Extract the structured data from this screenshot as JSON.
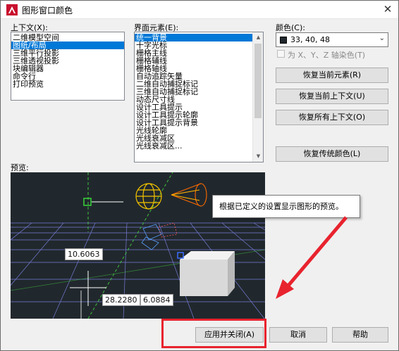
{
  "window": {
    "title": "图形窗口颜色",
    "close_glyph": "✕"
  },
  "context": {
    "label": "上下文(X):",
    "items": [
      "二维模型空间",
      "图纸/布局",
      "三维平行投影",
      "三维透视投影",
      "块编辑器",
      "命令行",
      "打印预览"
    ],
    "selected_index": 1
  },
  "elements": {
    "label": "界面元素(E):",
    "items": [
      "统一背景",
      "十字光标",
      "栅格主线",
      "栅格辅线",
      "栅格轴线",
      "自动追踪矢量",
      "二维自动捕捉标记",
      "三维自动捕捉标记",
      "动态尺寸线",
      "设计工具提示",
      "设计工具提示轮廓",
      "设计工具提示背景",
      "光线轮廓",
      "光线衰减区",
      "光线衰减区..."
    ],
    "selected_index": 0
  },
  "color": {
    "label": "颜色(C):",
    "value": "33, 40, 48",
    "swatch_hex": "#21282d",
    "tint_label": "为 X、Y、Z 轴染色(T)",
    "tint_checked": false
  },
  "buttons": {
    "restore_element": "恢复当前元素(R)",
    "restore_context": "恢复当前上下文(U)",
    "restore_all_contexts": "恢复所有上下文(O)",
    "restore_classic": "恢复传统颜色(L)",
    "apply_close": "应用并关闭(A)",
    "cancel": "取消",
    "help": "帮助"
  },
  "preview": {
    "label": "预览:",
    "tooltip": "根据已定义的设置显示图形的预览。",
    "dim_value": "10.6063",
    "coord_x": "28.2280",
    "coord_y": "6.0884",
    "background_hex": "#21282d"
  }
}
